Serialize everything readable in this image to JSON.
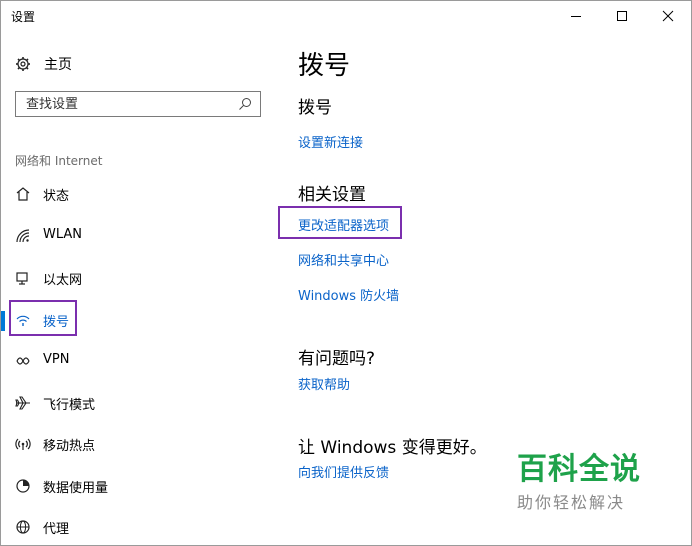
{
  "window": {
    "title": "设置",
    "controls": [
      "minimize",
      "maximize",
      "close"
    ]
  },
  "sidebar": {
    "home_label": "主页",
    "search_placeholder": "查找设置",
    "section_title": "网络和 Internet",
    "items": [
      {
        "label": "状态",
        "icon": "home-status-icon"
      },
      {
        "label": "WLAN",
        "icon": "wifi-icon"
      },
      {
        "label": "以太网",
        "icon": "ethernet-icon"
      },
      {
        "label": "拨号",
        "icon": "dialup-icon",
        "selected": true
      },
      {
        "label": "VPN",
        "icon": "vpn-icon"
      },
      {
        "label": "飞行模式",
        "icon": "airplane-icon"
      },
      {
        "label": "移动热点",
        "icon": "hotspot-icon"
      },
      {
        "label": "数据使用量",
        "icon": "data-usage-icon"
      },
      {
        "label": "代理",
        "icon": "globe-icon"
      }
    ]
  },
  "main": {
    "page_title": "拨号",
    "dialup_heading": "拨号",
    "new_connection_link": "设置新连接",
    "related_heading": "相关设置",
    "related_links": [
      "更改适配器选项",
      "网络和共享中心",
      "Windows 防火墙"
    ],
    "question_heading": "有问题吗?",
    "help_link": "获取帮助",
    "feedback_heading": "让 Windows 变得更好。",
    "feedback_link": "向我们提供反馈"
  },
  "watermark": {
    "title": "百科全说",
    "subtitle": "助你轻松解决"
  },
  "colors": {
    "link": "#0a63c9",
    "selection_bar": "#0078d7",
    "highlight_box": "#7b2fae",
    "watermark": "#1ea24a"
  }
}
